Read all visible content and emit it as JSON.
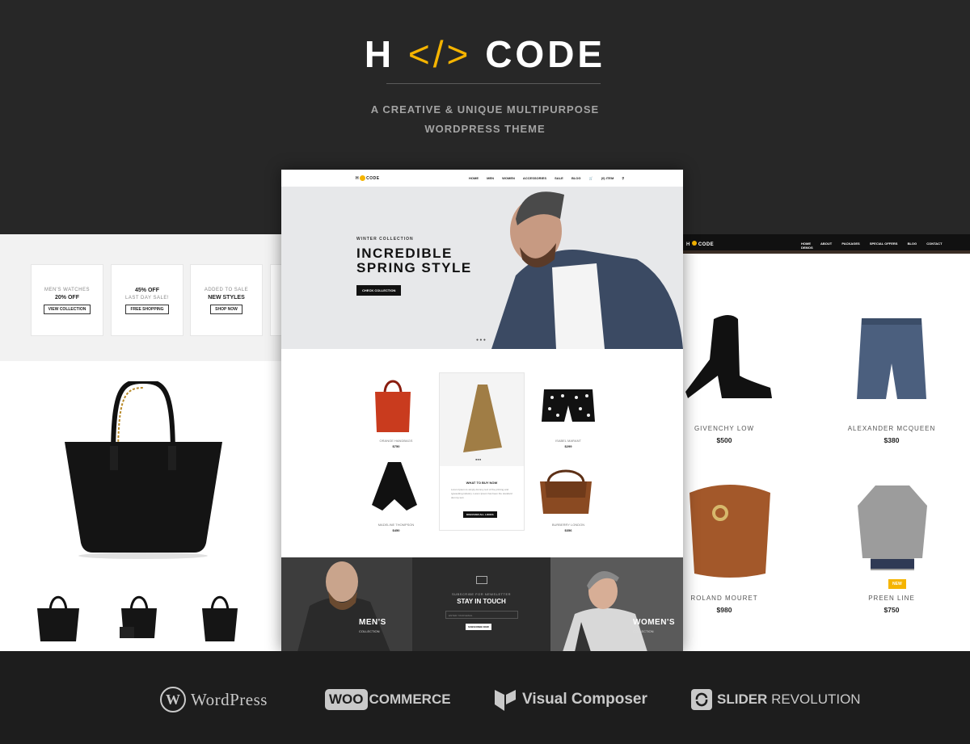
{
  "header": {
    "logo_left": "H",
    "logo_bracket": "</>",
    "logo_right": "CODE",
    "tagline_line1": "A CREATIVE & UNIQUE MULTIPURPOSE",
    "tagline_line2": "WORDPRESS THEME"
  },
  "left_screen": {
    "promos": [
      {
        "line1": "MEN'S WATCHES",
        "line2": "20% OFF",
        "button": "VIEW COLLECTION"
      },
      {
        "line1": "45% OFF",
        "line2": "LAST DAY SALE!",
        "button": "FREE SHOPPING"
      },
      {
        "line1": "ADDED TO SALE",
        "line2": "NEW STYLES",
        "button": "SHOP NOW"
      }
    ]
  },
  "center_screen": {
    "logo_left": "H",
    "logo_right": "CODE",
    "nav": [
      "HOME",
      "MEN",
      "WOMEN",
      "ACCESSORIES",
      "SALE",
      "BLOG"
    ],
    "cart": "(0) ITEM",
    "hero": {
      "subtitle": "WINTER COLLECTION",
      "title_line1": "INCREDIBLE",
      "title_line2": "SPRING STYLE",
      "cta": "CHECK COLLECTION"
    },
    "products": [
      {
        "name": "ORANGE HANDBAGS",
        "price": "$750"
      },
      {
        "name": "ISABEL MARANT",
        "price": "$299"
      },
      {
        "name": "MADELINE THOMPSON",
        "price": "$450"
      },
      {
        "name": "BURBERRY LONDON",
        "price": "$356"
      }
    ],
    "feature": {
      "heading": "WHAT TO BUY NOW",
      "text": "Lorem Ipsum is simply dummy text of the printing and typesetting industry. Lorem Ipsum has been the standard dummy text.",
      "button": "DISCOVER ALL LOOKS"
    },
    "newsletter": {
      "kicker": "SUBSCRIBE FOR NEWSLETTER",
      "title": "STAY IN TOUCH",
      "placeholder": "ENTER YOUR EMAIL",
      "button": "SUBSCRIBE NOW"
    },
    "mens": {
      "label": "MEN'S",
      "sub": "COLLECTION"
    },
    "womens": {
      "label": "WOMEN'S",
      "sub": "COLLECTION"
    }
  },
  "right_screen": {
    "logo_left": "H",
    "logo_right": "CODE",
    "nav": [
      "HOME",
      "ABOUT",
      "PACKAGES",
      "SPECIAL OFFERS",
      "BLOG",
      "CONTACT",
      "DEMOS"
    ],
    "products": [
      {
        "name": "GIVENCHY LOW",
        "price": "$500"
      },
      {
        "name": "ALEXANDER MCQUEEN",
        "price": "$380"
      },
      {
        "name": "ROLAND MOURET",
        "price": "$980"
      },
      {
        "name": "PREEN LINE",
        "price": "$750"
      }
    ],
    "badge": "NEW"
  },
  "brands": {
    "wordpress": "WordPress",
    "woo_box": "WOO",
    "woo_text": "COMMERCE",
    "vc": "Visual Composer",
    "sr_bold": "SLIDER",
    "sr_text": " REVOLUTION"
  },
  "colors": {
    "accent": "#f5b400",
    "background": "#262626",
    "bottom_bar": "#1d1d1d"
  }
}
